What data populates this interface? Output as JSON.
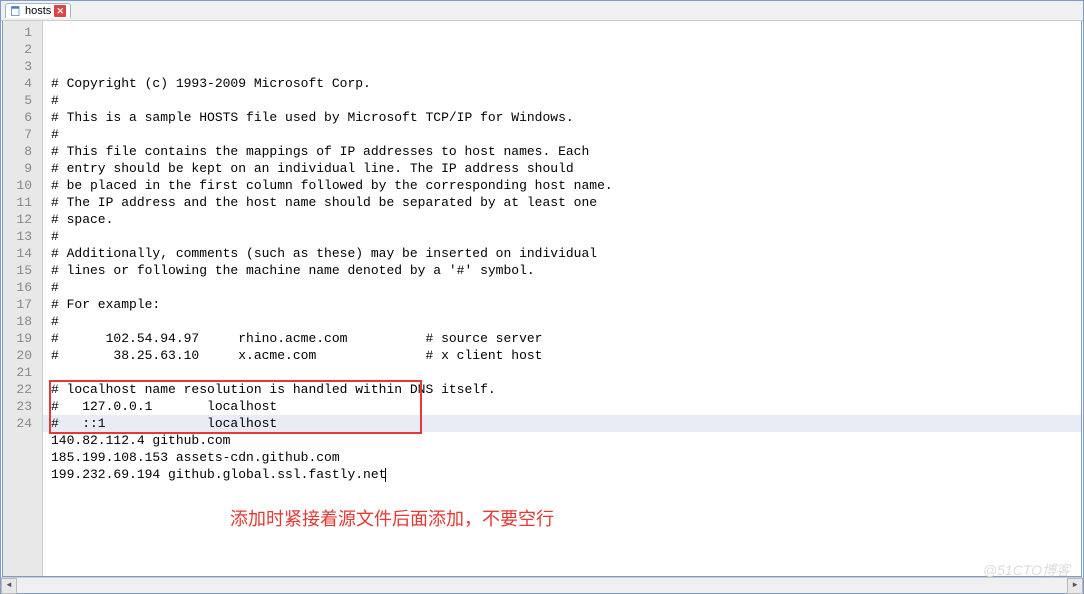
{
  "tab": {
    "filename": "hosts",
    "close": "✕"
  },
  "lines": [
    "# Copyright (c) 1993-2009 Microsoft Corp.",
    "#",
    "# This is a sample HOSTS file used by Microsoft TCP/IP for Windows.",
    "#",
    "# This file contains the mappings of IP addresses to host names. Each",
    "# entry should be kept on an individual line. The IP address should",
    "# be placed in the first column followed by the corresponding host name.",
    "# The IP address and the host name should be separated by at least one",
    "# space.",
    "#",
    "# Additionally, comments (such as these) may be inserted on individual",
    "# lines or following the machine name denoted by a '#' symbol.",
    "#",
    "# For example:",
    "#",
    "#      102.54.94.97     rhino.acme.com          # source server",
    "#       38.25.63.10     x.acme.com              # x client host",
    "",
    "# localhost name resolution is handled within DNS itself.",
    "#   127.0.0.1       localhost",
    "#   ::1             localhost",
    "140.82.112.4 github.com",
    "185.199.108.153 assets-cdn.github.com",
    "199.232.69.194 github.global.ssl.fastly.net"
  ],
  "line_count": 24,
  "annotation": "添加时紧接着源文件后面添加，不要空行",
  "watermark": "@51CTO博客",
  "scroll": {
    "left": "◄",
    "right": "►"
  }
}
